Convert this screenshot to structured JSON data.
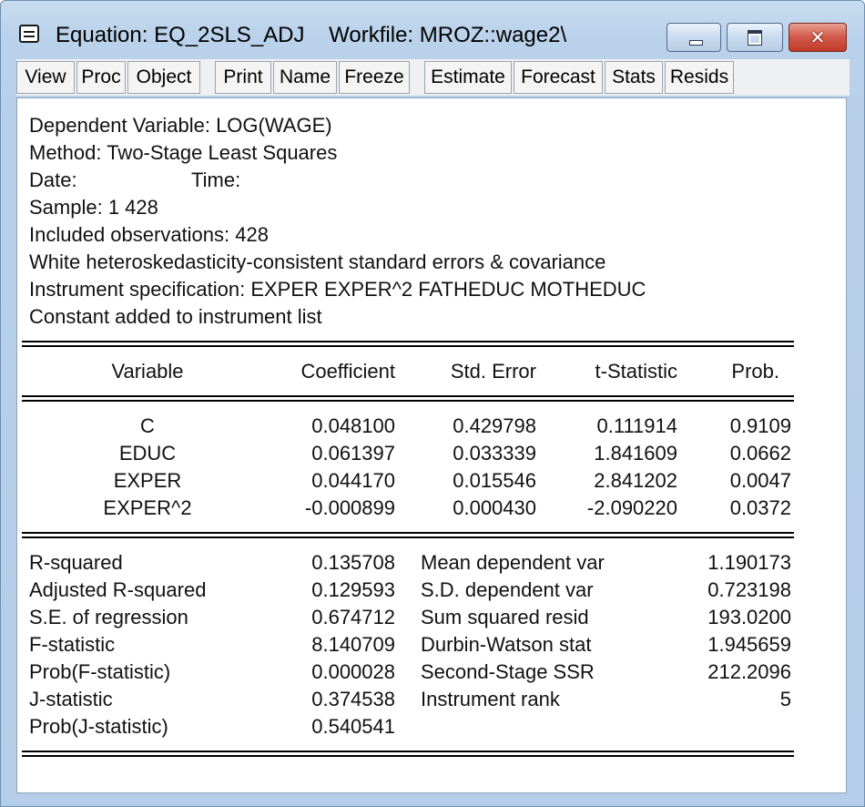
{
  "window": {
    "title": "Equation: EQ_2SLS_ADJ    Workfile: MROZ::wage2\\",
    "close_glyph": "✕"
  },
  "toolbar": {
    "buttons": [
      "View",
      "Proc",
      "Object",
      "Print",
      "Name",
      "Freeze",
      "Estimate",
      "Forecast",
      "Stats",
      "Resids"
    ]
  },
  "header": {
    "dependent": "Dependent Variable: LOG(WAGE)",
    "method": "Method: Two-Stage Least Squares",
    "date_label": "Date:",
    "time_label": "Time:",
    "sample": "Sample: 1 428",
    "observations": "Included observations: 428",
    "se_note": "White heteroskedasticity-consistent standard errors & covariance",
    "instruments": "Instrument specification: EXPER EXPER^2 FATHEDUC MOTHEDUC",
    "constant_note": "Constant added to instrument list"
  },
  "table": {
    "columns": [
      "Variable",
      "Coefficient",
      "Std. Error",
      "t-Statistic",
      "Prob."
    ],
    "rows": [
      [
        "C",
        "0.048100",
        "0.429798",
        "0.111914",
        "0.9109"
      ],
      [
        "EDUC",
        "0.061397",
        "0.033339",
        "1.841609",
        "0.0662"
      ],
      [
        "EXPER",
        "0.044170",
        "0.015546",
        "2.841202",
        "0.0047"
      ],
      [
        "EXPER^2",
        "-0.000899",
        "0.000430",
        "-2.090220",
        "0.0372"
      ]
    ]
  },
  "stats": {
    "left": [
      [
        "R-squared",
        "0.135708"
      ],
      [
        "Adjusted R-squared",
        "0.129593"
      ],
      [
        "S.E. of regression",
        "0.674712"
      ],
      [
        "F-statistic",
        "8.140709"
      ],
      [
        "Prob(F-statistic)",
        "0.000028"
      ],
      [
        "J-statistic",
        "0.374538"
      ],
      [
        "Prob(J-statistic)",
        "0.540541"
      ]
    ],
    "right": [
      [
        "Mean dependent var",
        "1.190173"
      ],
      [
        "S.D. dependent var",
        "0.723198"
      ],
      [
        "Sum squared resid",
        "193.0200"
      ],
      [
        "Durbin-Watson stat",
        "1.945659"
      ],
      [
        "Second-Stage SSR",
        "212.2096"
      ],
      [
        "Instrument rank",
        "5"
      ]
    ]
  }
}
